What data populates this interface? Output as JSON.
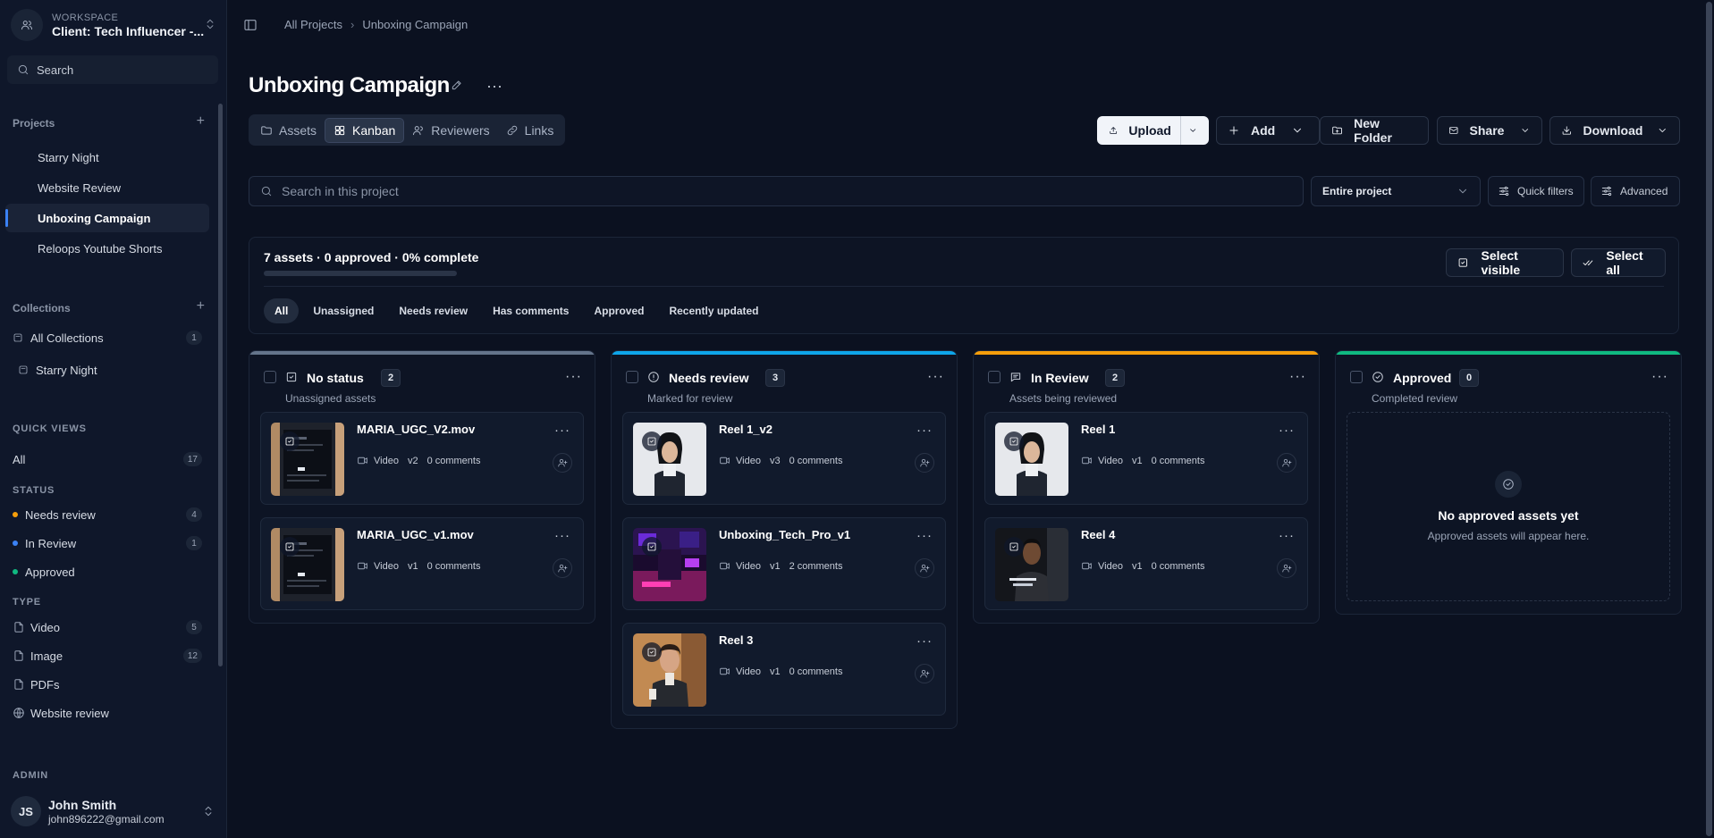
{
  "workspace": {
    "label": "WORKSPACE",
    "name": "Client: Tech Influencer -..."
  },
  "sidebar": {
    "search_placeholder": "Search",
    "projects_title": "Projects",
    "projects": [
      {
        "label": "Starry Night"
      },
      {
        "label": "Website Review"
      },
      {
        "label": "Unboxing Campaign"
      },
      {
        "label": "Reloops Youtube Shorts"
      }
    ],
    "collections_title": "Collections",
    "collections": [
      {
        "label": "All Collections",
        "count": "1"
      },
      {
        "label": "Starry Night"
      }
    ],
    "quick_views_title": "QUICK VIEWS",
    "quick_all": {
      "label": "All",
      "count": "17"
    },
    "status_title": "STATUS",
    "status": [
      {
        "label": "Needs review",
        "count": "4",
        "color": "#f59e0b"
      },
      {
        "label": "In Review",
        "count": "1",
        "color": "#3b82f6"
      },
      {
        "label": "Approved",
        "color": "#10b981"
      }
    ],
    "type_title": "TYPE",
    "types": [
      {
        "label": "Video",
        "count": "5",
        "icon": "video-icon"
      },
      {
        "label": "Image",
        "count": "12",
        "icon": "image-icon"
      },
      {
        "label": "PDFs",
        "icon": "file-icon"
      },
      {
        "label": "Website review",
        "icon": "globe-icon"
      }
    ],
    "admin_title": "ADMIN",
    "user": {
      "initials": "JS",
      "name": "John Smith",
      "email": "john896222@gmail.com"
    }
  },
  "breadcrumb": {
    "root": "All Projects",
    "current": "Unboxing Campaign"
  },
  "page": {
    "title": "Unboxing Campaign"
  },
  "view_tabs": [
    {
      "label": "Assets"
    },
    {
      "label": "Kanban"
    },
    {
      "label": "Reviewers"
    },
    {
      "label": "Links"
    }
  ],
  "toolbar": {
    "upload": "Upload",
    "add": "Add",
    "new_folder": "New Folder",
    "share": "Share",
    "download": "Download"
  },
  "search": {
    "placeholder": "Search in this project",
    "scope": "Entire project",
    "quick_filters": "Quick filters",
    "advanced": "Advanced"
  },
  "summary": {
    "text": "7 assets · 0 approved · 0% complete",
    "progress_percent": 0,
    "select_visible": "Select visible",
    "select_all": "Select all",
    "filters": [
      "All",
      "Unassigned",
      "Needs review",
      "Has comments",
      "Approved",
      "Recently updated"
    ]
  },
  "columns": [
    {
      "title": "No status",
      "count": "2",
      "subtitle": "Unassigned assets",
      "color": "#64748b",
      "icon": "check-square-icon",
      "cards": [
        {
          "name": "MARIA_UGC_V2.mov",
          "type": "Video",
          "version": "v2",
          "comments": "0 comments",
          "thumb": "ugc"
        },
        {
          "name": "MARIA_UGC_v1.mov",
          "type": "Video",
          "version": "v1",
          "comments": "0 comments",
          "thumb": "ugc"
        }
      ]
    },
    {
      "title": "Needs review",
      "count": "3",
      "subtitle": "Marked for review",
      "color": "#0ea5e9",
      "icon": "alert-circle-icon",
      "cards": [
        {
          "name": "Reel 1_v2",
          "type": "Video",
          "version": "v3",
          "comments": "0 comments",
          "thumb": "woman"
        },
        {
          "name": "Unboxing_Tech_Pro_v1",
          "type": "Video",
          "version": "v1",
          "comments": "2 comments",
          "thumb": "neon"
        },
        {
          "name": "Reel 3",
          "type": "Video",
          "version": "v1",
          "comments": "0 comments",
          "thumb": "man"
        }
      ]
    },
    {
      "title": "In Review",
      "count": "2",
      "subtitle": "Assets being reviewed",
      "color": "#f59e0b",
      "icon": "message-icon",
      "cards": [
        {
          "name": "Reel 1",
          "type": "Video",
          "version": "v1",
          "comments": "0 comments",
          "thumb": "woman"
        },
        {
          "name": "Reel 4",
          "type": "Video",
          "version": "v1",
          "comments": "0 comments",
          "thumb": "dark"
        }
      ]
    },
    {
      "title": "Approved",
      "count": "0",
      "subtitle": "Completed review",
      "color": "#10b981",
      "icon": "check-circle-icon",
      "cards": [],
      "empty_title": "No approved assets yet",
      "empty_sub": "Approved assets will appear here."
    }
  ]
}
